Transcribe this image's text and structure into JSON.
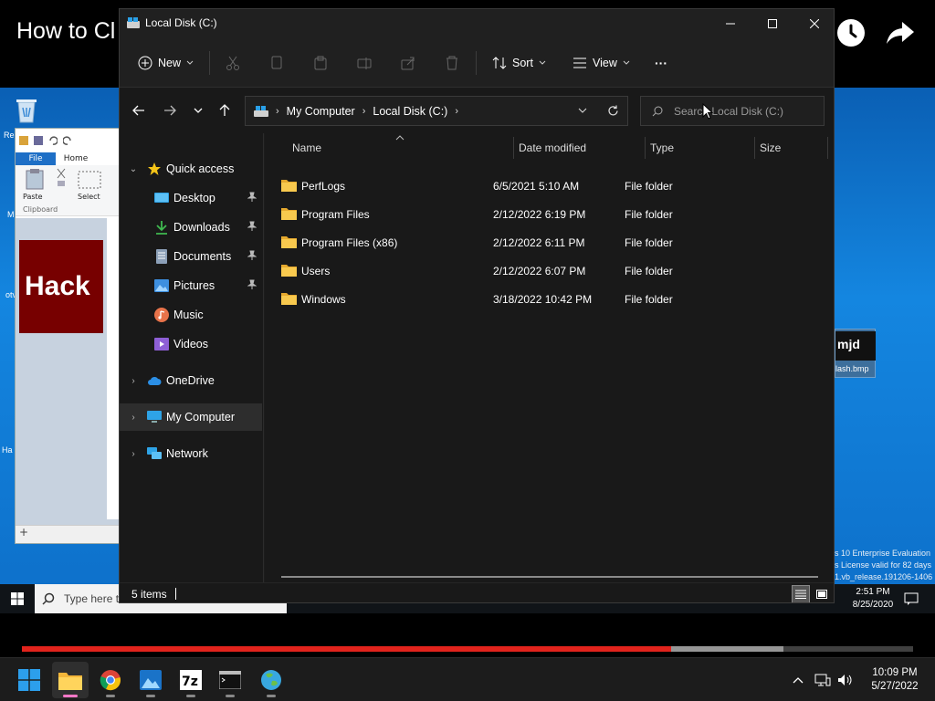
{
  "video": {
    "title": "How to Cl",
    "progress_played": 0.728,
    "progress_loaded": 0.855,
    "colors": {
      "played": "#e1231c"
    }
  },
  "inner_desktop": {
    "recycle_label": "Re",
    "paint": {
      "tab_file": "File",
      "tab_home": "Home",
      "paste_label": "Paste",
      "select_label": "Select",
      "clipboard_label": "Clipboard",
      "canvas_text": "Hack",
      "bottom_glyph": "+"
    },
    "desktop_file": {
      "thumb_text": "mjd",
      "name": "lash.bmp"
    },
    "watermark": [
      "s 10 Enterprise Evaluation",
      "s License valid for 82 days",
      "1.vb_release.191206-1406"
    ],
    "frag_m": "M",
    "frag_otv": "otv",
    "frag_ha": "Ha",
    "taskbar": {
      "search_placeholder": "Type here t",
      "time": "2:51 PM",
      "date": "8/25/2020"
    }
  },
  "explorer": {
    "title": "Local Disk (C:)",
    "toolbar": {
      "new_label": "New",
      "sort_label": "Sort",
      "view_label": "View",
      "more_label": "···"
    },
    "breadcrumb": [
      "My Computer",
      "Local Disk (C:)"
    ],
    "search_placeholder": "Search Local Disk (C:)",
    "nav": {
      "quick_access": "Quick access",
      "desktop": "Desktop",
      "downloads": "Downloads",
      "documents": "Documents",
      "pictures": "Pictures",
      "music": "Music",
      "videos": "Videos",
      "onedrive": "OneDrive",
      "my_computer": "My Computer",
      "network": "Network"
    },
    "columns": {
      "name": "Name",
      "date": "Date modified",
      "type": "Type",
      "size": "Size"
    },
    "files": [
      {
        "name": "PerfLogs",
        "date": "6/5/2021 5:10 AM",
        "type": "File folder",
        "size": ""
      },
      {
        "name": "Program Files",
        "date": "2/12/2022 6:19 PM",
        "type": "File folder",
        "size": ""
      },
      {
        "name": "Program Files (x86)",
        "date": "2/12/2022 6:11 PM",
        "type": "File folder",
        "size": ""
      },
      {
        "name": "Users",
        "date": "2/12/2022 6:07 PM",
        "type": "File folder",
        "size": ""
      },
      {
        "name": "Windows",
        "date": "3/18/2022 10:42 PM",
        "type": "File folder",
        "size": ""
      }
    ],
    "status": "5 items",
    "colors": {
      "folder": "#f8c94e",
      "background": "#191919",
      "selected": "#2d2d2d"
    }
  },
  "host_taskbar": {
    "apps": [
      "windows-start-icon",
      "file-explorer-icon",
      "chrome-icon",
      "photos-icon",
      "7zip-icon",
      "terminal-icon",
      "network-globe-icon"
    ],
    "sevenzip_text": "7z",
    "time": "10:09 PM",
    "date": "5/27/2022"
  }
}
